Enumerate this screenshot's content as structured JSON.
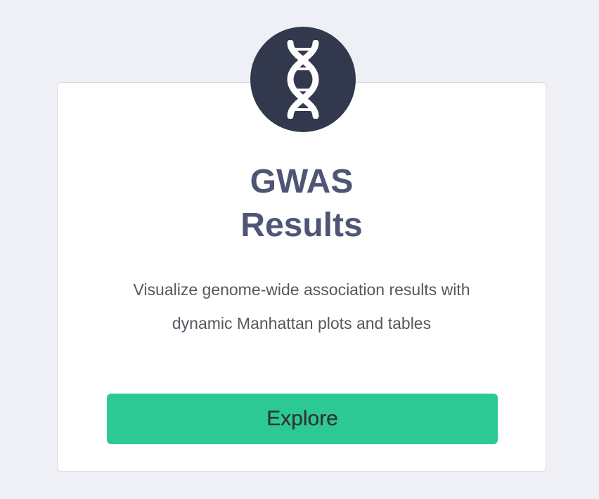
{
  "card": {
    "icon": "dna-icon",
    "title_line1": "GWAS",
    "title_line2": "Results",
    "description_line1": "Visualize genome-wide association results with",
    "description_line2": "dynamic Manhattan plots and tables",
    "button_label": "Explore"
  },
  "colors": {
    "background": "#eff0f5",
    "icon_circle": "#32394d",
    "title": "#4f5574",
    "button": "#2dc995",
    "button_text": "#2e3338"
  }
}
